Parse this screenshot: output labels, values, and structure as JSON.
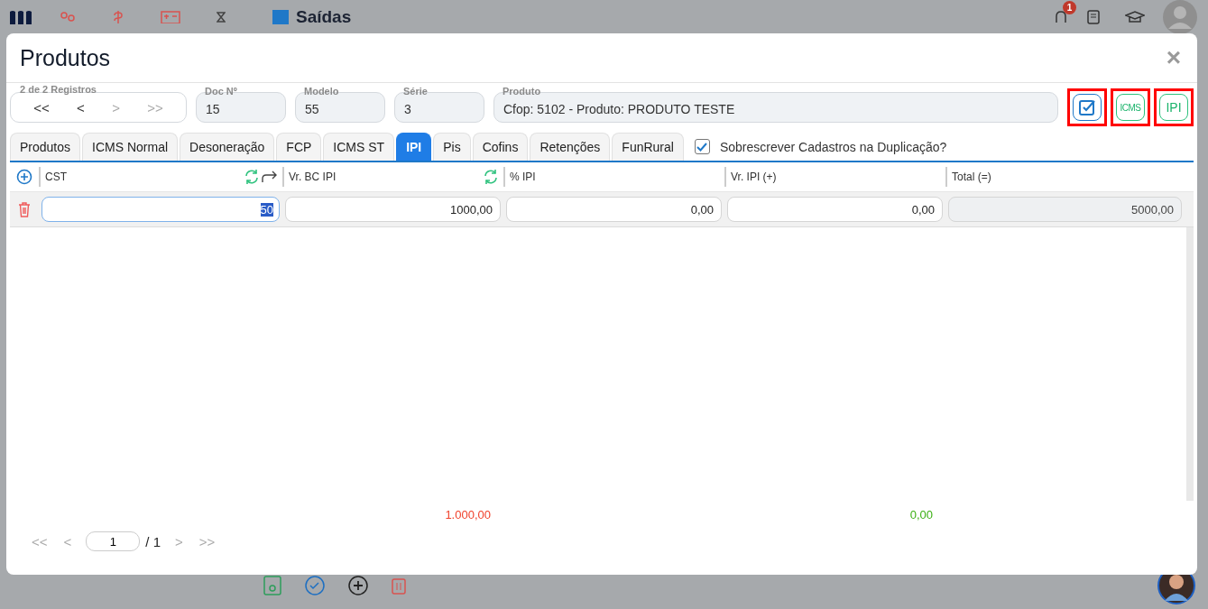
{
  "background": {
    "app_title": "Saídas",
    "notification_count": "1"
  },
  "modal": {
    "title": "Produtos",
    "close": "×",
    "navigator": {
      "legend": "2 de 2 Registros",
      "buttons": [
        {
          "label": "<<",
          "disabled": false
        },
        {
          "label": "<",
          "disabled": false
        },
        {
          "label": ">",
          "disabled": true
        },
        {
          "label": ">>",
          "disabled": true
        }
      ]
    },
    "fields": [
      {
        "label": "Doc Nº",
        "value": "15"
      },
      {
        "label": "Modelo",
        "value": "55"
      },
      {
        "label": "Série",
        "value": "3"
      },
      {
        "label": "Produto",
        "value": "Cfop: 5102 - Produto: PRODUTO TESTE"
      }
    ],
    "action_buttons": [
      {
        "kind": "check",
        "highlighted": true
      },
      {
        "kind": "text",
        "label": "ICMS",
        "highlighted": true
      },
      {
        "kind": "text",
        "label": "IPI",
        "highlighted": true
      }
    ],
    "tabs": [
      {
        "label": "Produtos",
        "selected": false
      },
      {
        "label": "ICMS Normal",
        "selected": false
      },
      {
        "label": "Desoneração",
        "selected": false
      },
      {
        "label": "FCP",
        "selected": false
      },
      {
        "label": "ICMS ST",
        "selected": false
      },
      {
        "label": "IPI",
        "selected": true
      },
      {
        "label": "Pis",
        "selected": false
      },
      {
        "label": "Cofins",
        "selected": false
      },
      {
        "label": "Retenções",
        "selected": false
      },
      {
        "label": "FunRural",
        "selected": false
      }
    ],
    "overwrite": {
      "label": "Sobrescrever Cadastros na Duplicação?",
      "checked": true
    },
    "table": {
      "columns": [
        {
          "label": "CST",
          "refresh_button": true,
          "redo_button": true
        },
        {
          "label": "Vr. BC IPI",
          "refresh_button": true,
          "total": {
            "value": "1.000,00",
            "color": "#f0412b"
          }
        },
        {
          "label": "% IPI"
        },
        {
          "label": "Vr. IPI (+)",
          "total": {
            "value": "0,00",
            "color": "#3cb014"
          }
        },
        {
          "label": "Total (=)"
        }
      ],
      "rows": [
        {
          "cells": [
            {
              "value": "50",
              "text_selected": true,
              "readonly": false
            },
            {
              "value": "1000,00",
              "text_selected": false,
              "readonly": false
            },
            {
              "value": "0,00",
              "text_selected": false,
              "readonly": false
            },
            {
              "value": "0,00",
              "text_selected": false,
              "readonly": false
            },
            {
              "value": "5000,00",
              "text_selected": false,
              "readonly": true
            }
          ]
        }
      ]
    },
    "pager": {
      "first": "<<",
      "prev": "<",
      "page": "1",
      "of": "/ 1",
      "next": ">",
      "last": ">>"
    }
  }
}
